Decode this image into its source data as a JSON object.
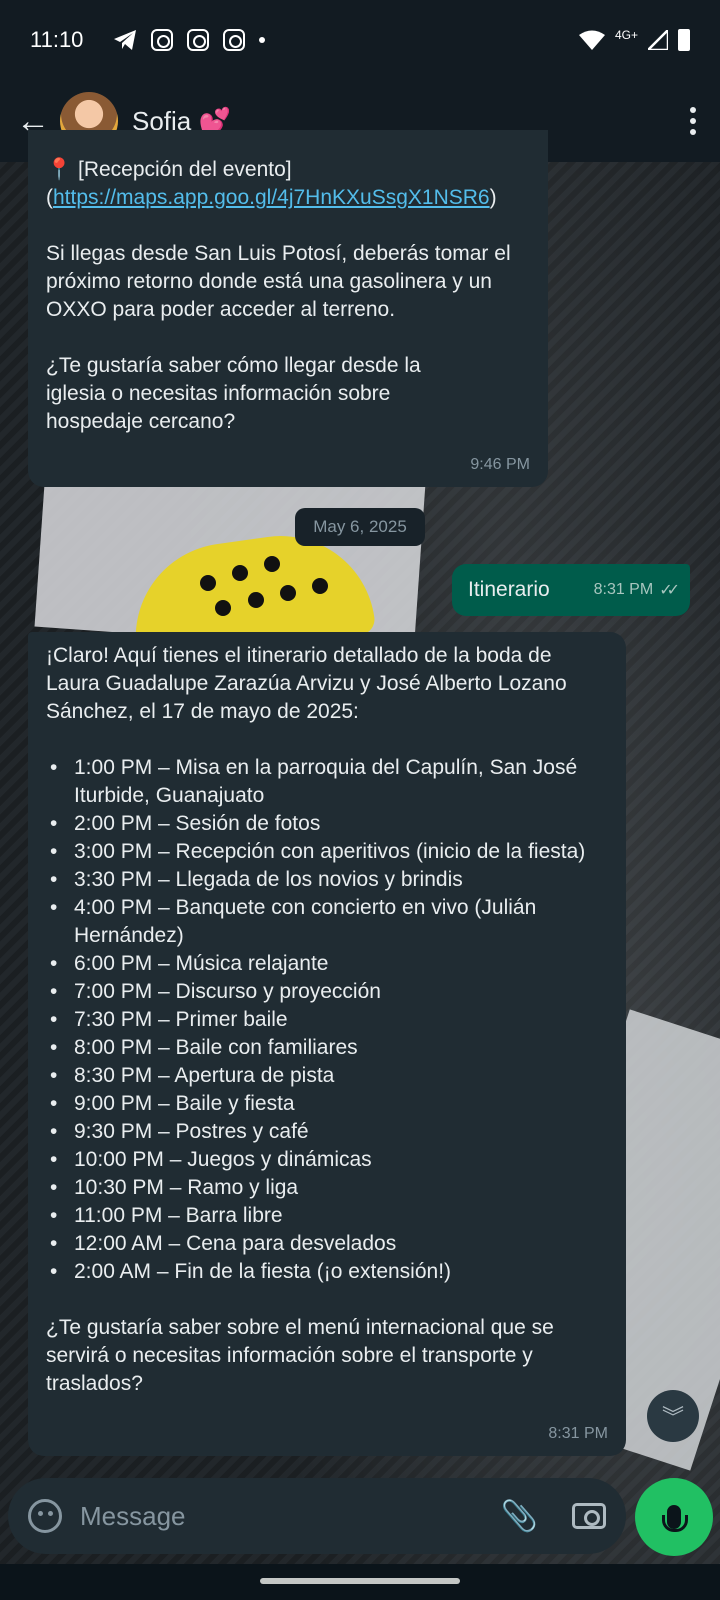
{
  "status_bar": {
    "time": "11:10",
    "network": "4G+"
  },
  "header": {
    "contact_name": "Sofia 💕"
  },
  "messages": {
    "msg1": {
      "location_label": "📍 [Recepción del evento](",
      "link": "https://maps.app.goo.gl/4j7HnKXuSsgX1NSR6",
      "link_close": ")",
      "para1": "Si llegas desde San Luis Potosí, deberás tomar el próximo retorno donde está una gasolinera y un OXXO para poder acceder al terreno.",
      "para2": "¿Te gustaría saber cómo llegar desde la iglesia o necesitas información sobre hospedaje cercano?",
      "time": "9:46 PM"
    },
    "date_chip": "May 6, 2025",
    "sent": {
      "text": "Itinerario",
      "time": "8:31 PM"
    },
    "msg2": {
      "intro": "¡Claro! Aquí tienes el itinerario detallado de la boda de Laura Guadalupe Zarazúa Arvizu y José Alberto Lozano Sánchez, el 17 de mayo de 2025:",
      "items": [
        "1:00 PM – Misa en la parroquia del Capulín, San José Iturbide, Guanajuato",
        "2:00 PM – Sesión de fotos",
        "3:00 PM – Recepción con aperitivos (inicio de la fiesta)",
        "3:30 PM – Llegada de los novios y brindis",
        "4:00 PM – Banquete con concierto en vivo (Julián Hernández)",
        "6:00 PM – Música relajante",
        "7:00 PM – Discurso y proyección",
        "7:30 PM – Primer baile",
        "8:00 PM – Baile con familiares",
        "8:30 PM – Apertura de pista",
        "9:00 PM – Baile y fiesta",
        "9:30 PM – Postres y café",
        "10:00 PM – Juegos y dinámicas",
        "10:30 PM – Ramo y liga",
        "11:00 PM – Barra libre",
        "12:00 AM – Cena para desvelados",
        "2:00 AM – Fin de la fiesta (¡o extensión!)"
      ],
      "outro": "¿Te gustaría saber sobre el menú internacional que se servirá o necesitas información sobre el transporte y traslados?",
      "time": "8:31 PM"
    }
  },
  "input": {
    "placeholder": "Message"
  },
  "colors": {
    "incoming_bubble": "#202c33",
    "outgoing_bubble": "#005c4b",
    "accent_green": "#21c063",
    "link": "#53bdeb"
  }
}
